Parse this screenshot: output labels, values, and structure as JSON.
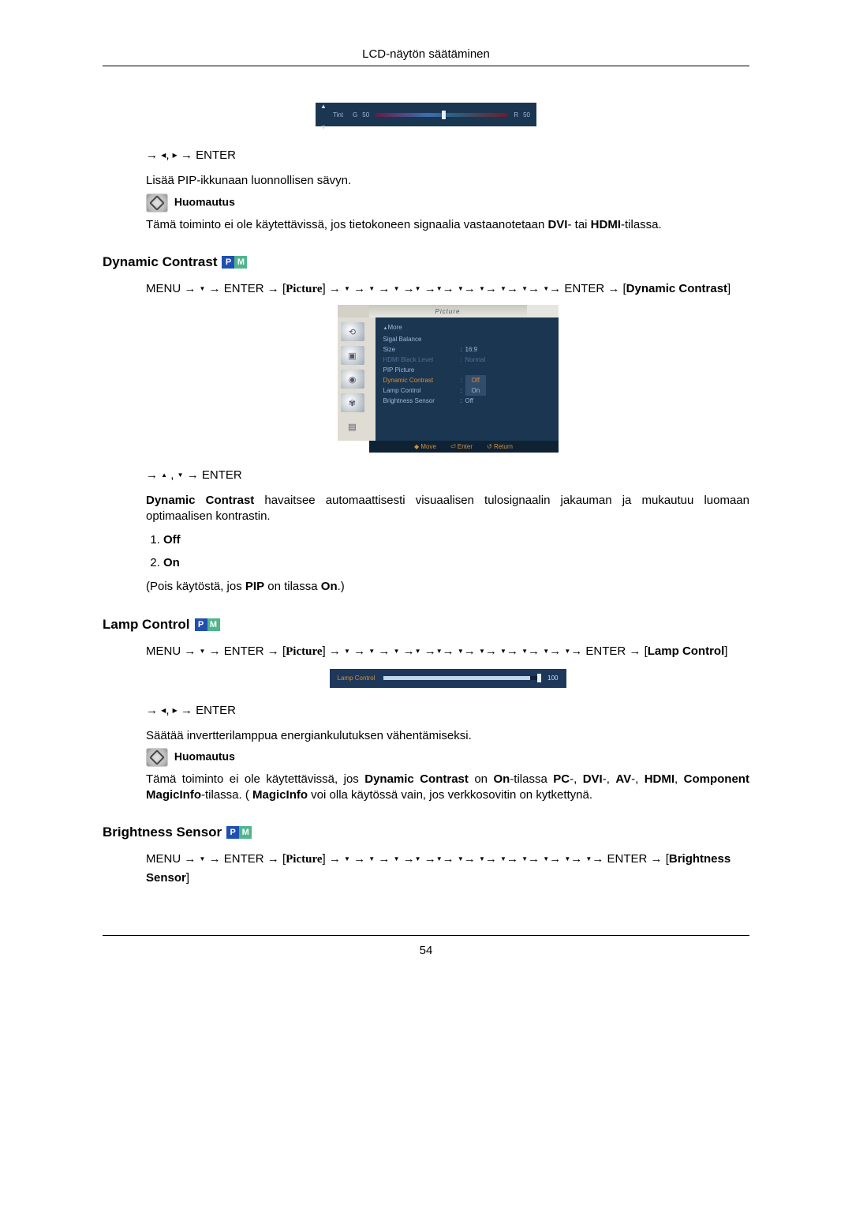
{
  "header": {
    "title": "LCD-näytön säätäminen"
  },
  "tintOsd": {
    "label": "Tint",
    "g": "G",
    "gv": "50",
    "r": "R",
    "rv": "50"
  },
  "section_tint_tail": {
    "nav_enter": "ENTER",
    "pip_text": "Lisää PIP-ikkunaan luonnollisen sävyn.",
    "note_label": "Huomautus",
    "note_body_a": "Tämä toiminto ei ole käytettävissä, jos tietokoneen signaalia vastaanotetaan ",
    "note_body_b": "DVI",
    "note_body_c": "- tai ",
    "note_body_d": "HDMI",
    "note_body_e": "-tilassa."
  },
  "dynamic": {
    "title": "Dynamic Contrast",
    "path_menu": "MENU",
    "path_enter": "ENTER",
    "path_picture": "Picture",
    "path_tag": "Dynamic Contrast",
    "nav_enter": "ENTER",
    "desc_b": "Dynamic Contrast",
    "desc_t": " havaitsee automaattisesti visuaalisen tulosignaalin jakauman ja mukautuu luomaan optimaalisen kontrastin.",
    "opt1": "Off",
    "opt2": "On",
    "pip_a": "(Pois käytöstä, jos ",
    "pip_b": "PIP",
    "pip_c": " on tilassa ",
    "pip_d": "On",
    "pip_e": ".)"
  },
  "picture_osd": {
    "title": "Picture",
    "rows": {
      "more": "More",
      "sigal": "Sigal Balance",
      "size_l": "Size",
      "size_v": "16:9",
      "hdmi_l": "HDMI Black Level",
      "hdmi_v": "Normal",
      "pip": "PIP Picture",
      "dc_l": "Dynamic Contrast",
      "dc_v": "Off",
      "lamp_l": "Lamp Control",
      "lamp_v": "On",
      "bs_l": "Brightness Sensor",
      "bs_v": "Off"
    },
    "hints": {
      "move": "Move",
      "enter": "Enter",
      "return": "Return"
    }
  },
  "lamp": {
    "title": "Lamp Control",
    "path_menu": "MENU",
    "path_enter": "ENTER",
    "path_picture": "Picture",
    "path_tag": "Lamp Control",
    "osd_label": "Lamp Control",
    "osd_value": "100",
    "nav_enter": "ENTER",
    "desc": "Säätää invertterilamppua energiankulutuksen vähentämiseksi.",
    "note_label": "Huomautus",
    "note_a": "Tämä toiminto ei ole käytettävissä, jos ",
    "note_b": "Dynamic Contrast",
    "note_c": " on ",
    "note_d": "On",
    "note_e": "-tilassa ",
    "note_f": "PC",
    "note_g": "-, ",
    "note_h": "DVI",
    "note_i": "-, ",
    "note_j": "AV",
    "note_k": "-, ",
    "note_l": "HDMI",
    "note_m": ", ",
    "note_n": "Component MagicInfo",
    "note_o": "-tilassa. ( ",
    "note_p": "MagicInfo",
    "note_q": " voi olla käytössä vain, jos verkkosovitin on kytkettynä."
  },
  "brightness": {
    "title": "Brightness Sensor",
    "path_menu": "MENU",
    "path_enter": "ENTER",
    "path_picture": "Picture",
    "path_end_enter": "ENTER",
    "path_tag": "Brightness Sensor"
  },
  "footer": {
    "page": "54"
  }
}
